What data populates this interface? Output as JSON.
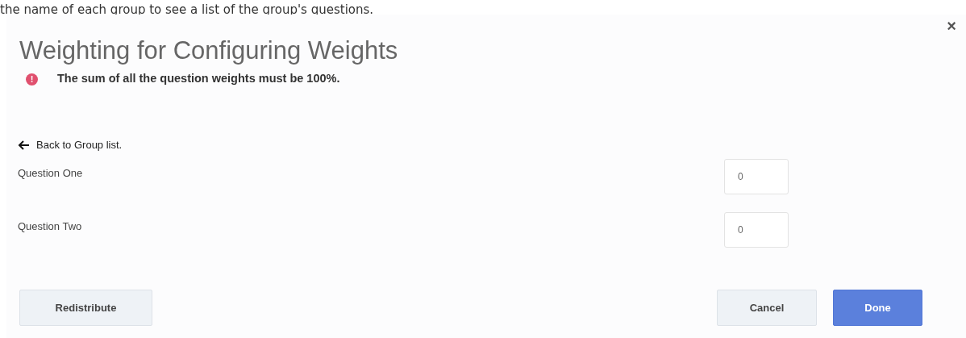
{
  "page_text": "the name of each group to see a list of the group's questions.",
  "dialog": {
    "title": "Weighting for Configuring Weights",
    "close": "×",
    "alert": {
      "icon": "!",
      "message": "The sum of all the question weights must be 100%."
    },
    "back_link": "Back to Group list.",
    "questions": [
      {
        "label": "Question One",
        "weight": "0"
      },
      {
        "label": "Question Two",
        "weight": "0"
      }
    ],
    "buttons": [
      {
        "label": "Redistribute",
        "kind": "secondary"
      },
      {
        "label": "Cancel",
        "kind": "secondary"
      },
      {
        "label": "Done",
        "kind": "primary"
      }
    ]
  }
}
